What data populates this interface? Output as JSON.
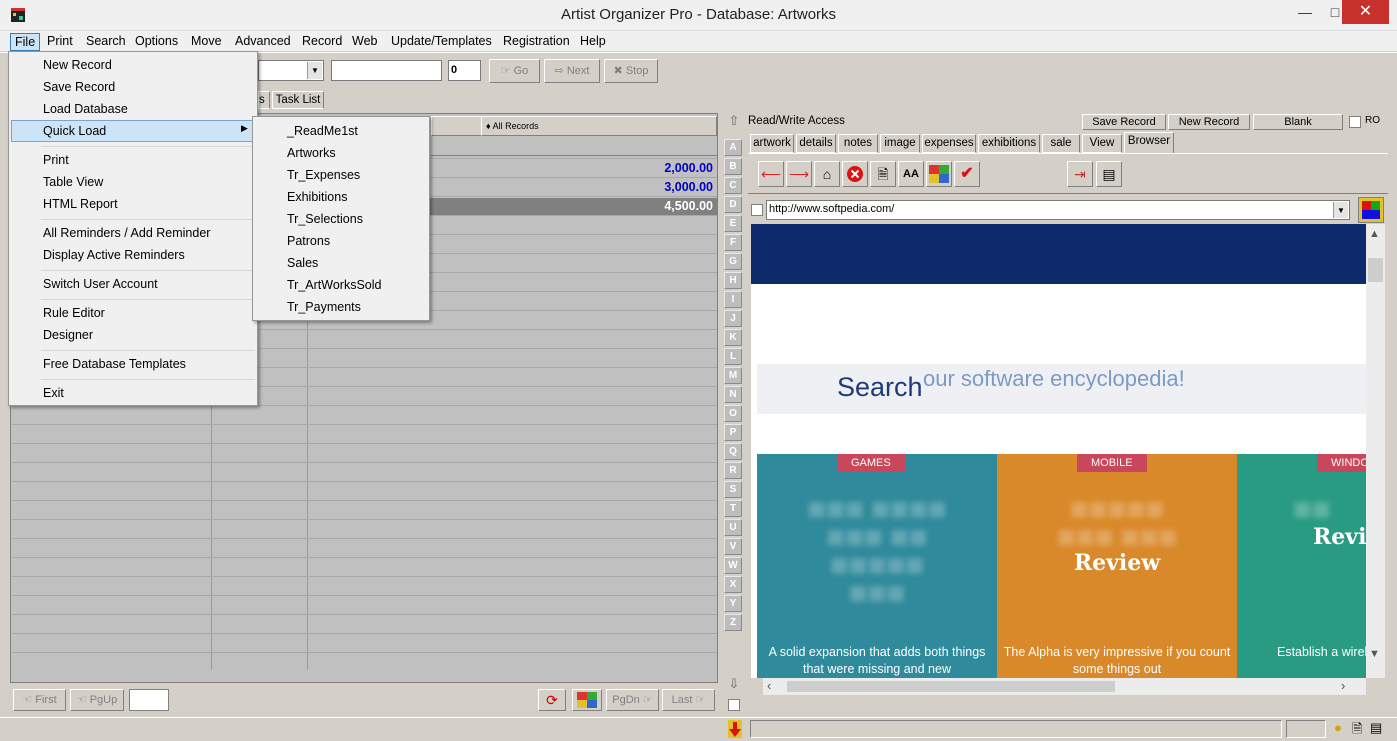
{
  "window": {
    "title": "Artist Organizer Pro - Database: Artworks"
  },
  "menubar": [
    "File",
    "Print",
    "Search",
    "Options",
    "Move",
    "Advanced",
    "Record",
    "Web",
    "Update/Templates",
    "Registration",
    "Help"
  ],
  "toolbar": {
    "count_value": "0",
    "go_label": "Go",
    "next_label": "Next",
    "stop_label": "Stop"
  },
  "left": {
    "tab_fragment": "s",
    "task_list_tab": "Task List",
    "all_records_label": "All Records",
    "amounts": [
      "2,000.00",
      "3,000.00",
      "4,500.00"
    ],
    "nav": {
      "first": "First",
      "pgup": "PgUp",
      "pgdn": "PgDn",
      "last": "Last"
    }
  },
  "alphabet": [
    "A",
    "B",
    "C",
    "D",
    "E",
    "F",
    "G",
    "H",
    "I",
    "J",
    "K",
    "L",
    "M",
    "N",
    "O",
    "P",
    "Q",
    "R",
    "S",
    "T",
    "U",
    "V",
    "W",
    "X",
    "Y",
    "Z"
  ],
  "right": {
    "access_label": "Read/Write Access",
    "save_record": "Save Record",
    "new_record": "New Record",
    "blank": "Blank",
    "ro_label": "RO",
    "tabs": [
      "artwork",
      "details",
      "notes",
      "image",
      "expenses",
      "exhibitions",
      "sale",
      "View",
      "Browser"
    ],
    "active_tab": "Browser",
    "url": "http://www.softpedia.com/",
    "page": {
      "search_word": "Search",
      "search_tagline": "our software encyclopedia!",
      "tiles": [
        {
          "badge": "GAMES",
          "headline": "",
          "caption": "A solid expansion that adds both things that were missing and new",
          "color": "#2f8a9c"
        },
        {
          "badge": "MOBILE",
          "headline": "Review",
          "caption": "The Alpha is very impressive if you count some things out",
          "color": "#d9892a"
        },
        {
          "badge": "WINDO",
          "headline": "Revi",
          "caption": "Establish a wirele from a PC to a",
          "color": "#2a9b83"
        }
      ]
    }
  },
  "file_menu": {
    "items": [
      "New Record",
      "Save Record",
      "Load Database",
      "Quick Load",
      "Print",
      "Table View",
      "HTML Report",
      "All Reminders / Add Reminder",
      "Display Active Reminders",
      "Switch User Account",
      "Rule Editor",
      "Designer",
      "Free Database Templates",
      "Exit"
    ]
  },
  "quick_load_menu": {
    "items": [
      "_ReadMe1st",
      "Artworks",
      "Tr_Expenses",
      "Exhibitions",
      "Tr_Selections",
      "Patrons",
      "Sales",
      "Tr_ArtWorksSold",
      "Tr_Payments"
    ]
  },
  "colors": {
    "softpedia_navy": "#0d2a6b",
    "badge": "#c8475a",
    "amount_blue": "#0000cc",
    "highlight": "#cce4f7"
  }
}
